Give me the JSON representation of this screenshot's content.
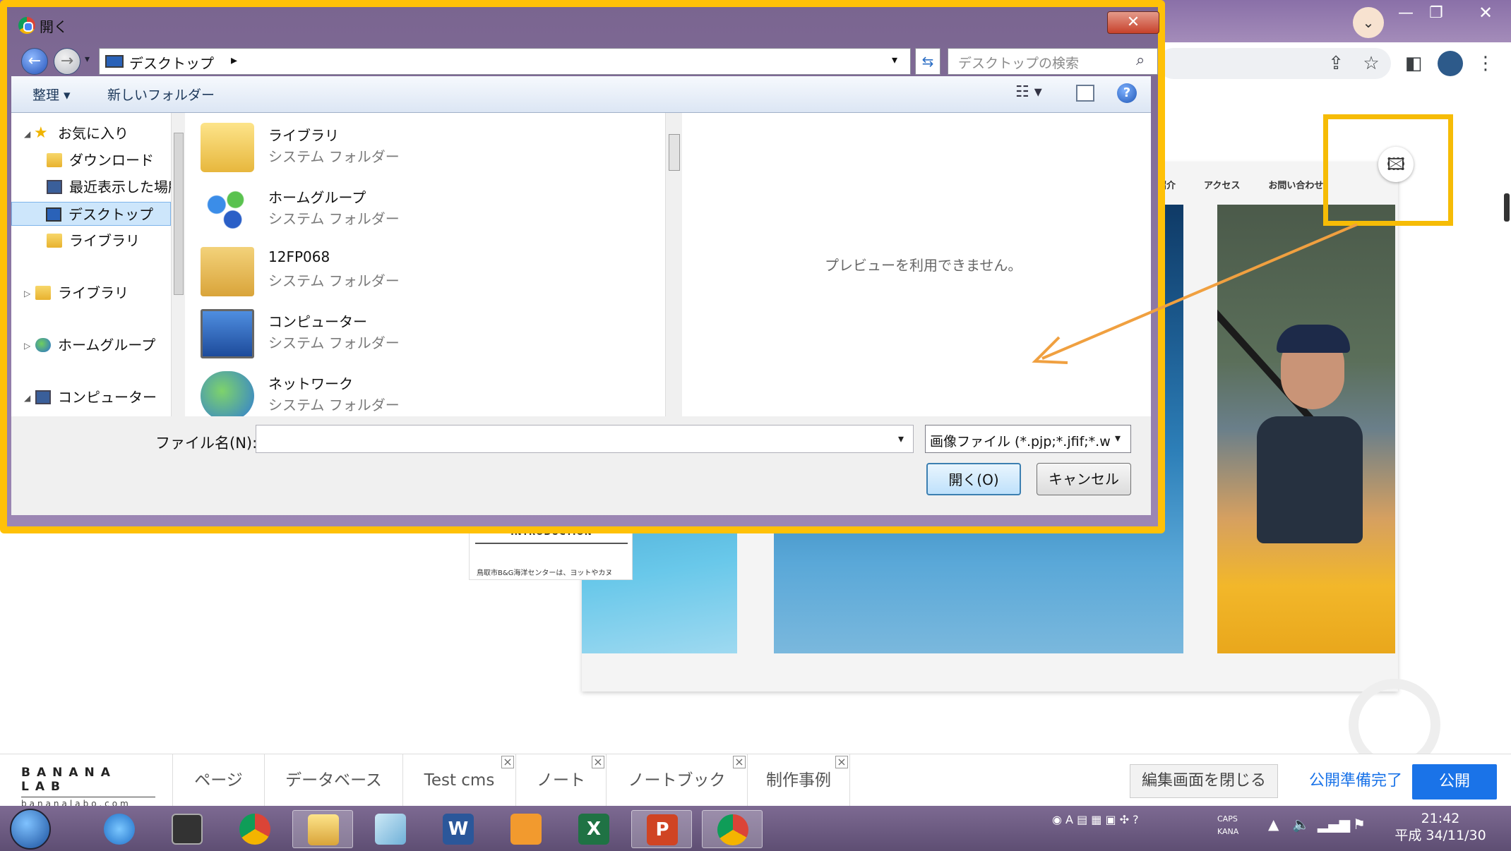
{
  "dialog": {
    "title": "開く",
    "close_symbol": "✕",
    "address": {
      "location": "デスクトップ",
      "chevron": "▸",
      "dropdown": "▾"
    },
    "search": {
      "placeholder": "デスクトップの検索"
    },
    "command_bar": {
      "organize": "整理 ▾",
      "new_folder": "新しいフォルダー",
      "view": "☷ ▾",
      "help": "?"
    },
    "nav_pane": {
      "items": [
        {
          "label": "お気に入り",
          "icon": "star-icon"
        },
        {
          "label": "ダウンロード",
          "icon": "download-folder-icon"
        },
        {
          "label": "最近表示した場所",
          "icon": "recent-places-icon"
        },
        {
          "label": "デスクトップ",
          "icon": "desktop-icon",
          "selected": true
        },
        {
          "label": "ライブラリ",
          "icon": "library-icon"
        },
        {
          "label": "ライブラリ",
          "icon": "library-icon"
        },
        {
          "label": "ホームグループ",
          "icon": "homegroup-icon"
        },
        {
          "label": "コンピューター",
          "icon": "computer-icon"
        }
      ]
    },
    "files": [
      {
        "name": "ライブラリ",
        "type": "システム フォルダー",
        "icon": "library-folder-icon"
      },
      {
        "name": "ホームグループ",
        "type": "システム フォルダー",
        "icon": "homegroup-icon"
      },
      {
        "name": "12FP068",
        "type": "システム フォルダー",
        "icon": "user-folder-icon"
      },
      {
        "name": "コンピューター",
        "type": "システム フォルダー",
        "icon": "computer-icon"
      },
      {
        "name": "ネットワーク",
        "type": "システム フォルダー",
        "icon": "network-icon"
      }
    ],
    "preview_text": "プレビューを利用できません。",
    "filename_label": "ファイル名(N):",
    "filename_value": "",
    "filter": "画像ファイル (*.pjp;*.jfif;*.w",
    "open_button": "開く(O)",
    "cancel_button": "キャンセル"
  },
  "website": {
    "nav": [
      "設のご紹介",
      "アクセス",
      "お問い合わせ"
    ],
    "intro_title": "INTRODUCTION",
    "intro_text": "鳥取市B&G海洋センターは、ヨットやカヌ",
    "add_image_symbol": "🖾"
  },
  "cms_bar": {
    "logo_top": "BANANA LAB",
    "logo_bottom": "bananalabo.com",
    "tabs": [
      {
        "label": "ページ",
        "closable": false
      },
      {
        "label": "データベース",
        "closable": false
      },
      {
        "label": "Test cms",
        "closable": true
      },
      {
        "label": "ノート",
        "closable": true
      },
      {
        "label": "ノートブック",
        "closable": true
      },
      {
        "label": "制作事例",
        "closable": true
      }
    ],
    "close_edit": "編集画面を閉じる",
    "prepare": "公開準備完了",
    "publish": "公開"
  },
  "taskbar": {
    "caps": "CAPS",
    "kana": "KANA",
    "time": "21:42",
    "date": "平成 34/11/30"
  },
  "colors": {
    "highlight": "#f6bc06",
    "arrow": "#f0a040",
    "accent_blue": "#1a73e8"
  }
}
